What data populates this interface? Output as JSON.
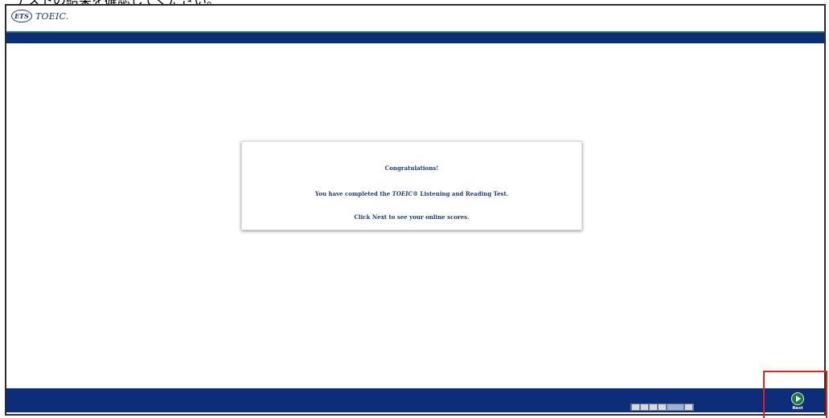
{
  "caption": "テストの結果を確認してください。",
  "header": {
    "logo_ets": "ETS",
    "logo_text": "TOEIC."
  },
  "dialog": {
    "line1": "Congratulations!",
    "line2_prefix": "You have completed the ",
    "line2_emph": "TOEIC®",
    "line2_suffix": " Listening and Reading Test.",
    "line3": "Click Next to see your online scores."
  },
  "footer": {
    "next_label": "Next"
  },
  "colors": {
    "brand_blue": "#0c2e79",
    "accent_green": "#1f6f59",
    "text_blue": "#1c3f78",
    "next_green": "#1e7a3c",
    "highlight_red": "#e2231a"
  },
  "icons": {
    "next": "play-circle-icon",
    "taskbar": "taskbar-icons"
  }
}
